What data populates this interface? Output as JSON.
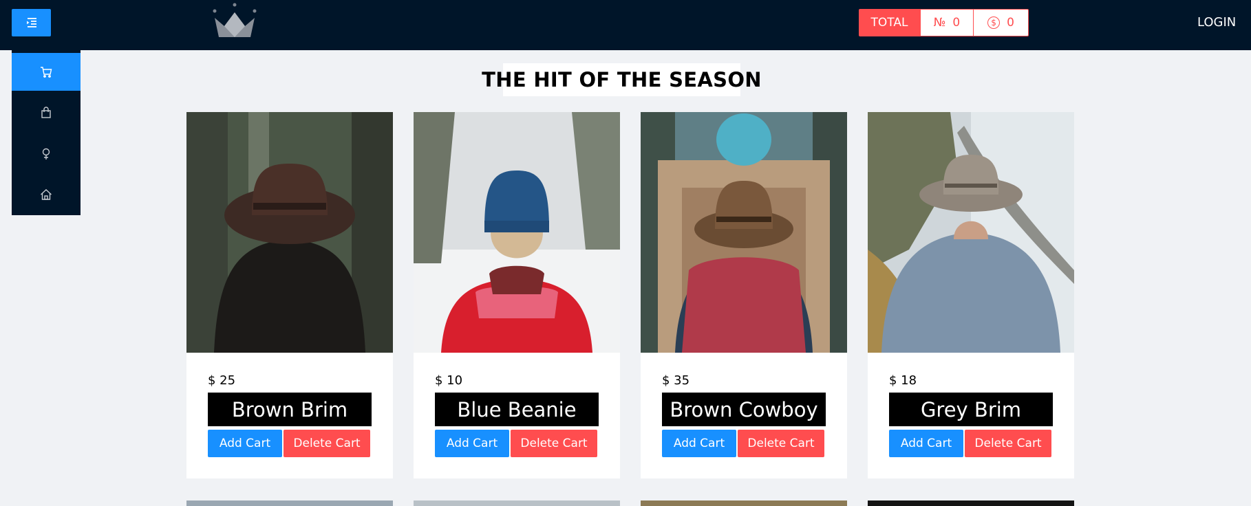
{
  "header": {
    "totals": {
      "label": "TOTAL",
      "count_symbol": "№",
      "count": "0",
      "money_symbol": "$",
      "money": "0"
    },
    "login_label": "LOGIN"
  },
  "sidebar": {
    "items": [
      "cart-icon",
      "bag-icon",
      "female-icon",
      "home-icon"
    ]
  },
  "main": {
    "title": "THE HIT OF THE SEASON",
    "products": [
      {
        "price": "$ 25",
        "name": "Brown Brim",
        "add_label": "Add Cart",
        "delete_label": "Delete Cart"
      },
      {
        "price": "$ 10",
        "name": "Blue Beanie",
        "add_label": "Add Cart",
        "delete_label": "Delete Cart"
      },
      {
        "price": "$ 35",
        "name": "Brown Cowboy",
        "add_label": "Add Cart",
        "delete_label": "Delete Cart"
      },
      {
        "price": "$ 18",
        "name": "Grey Brim",
        "add_label": "Add Cart",
        "delete_label": "Delete Cart"
      }
    ]
  },
  "colors": {
    "header_bg": "#001529",
    "primary": "#1890ff",
    "danger": "#ff4d4f",
    "page_bg": "#f0f2f5"
  }
}
